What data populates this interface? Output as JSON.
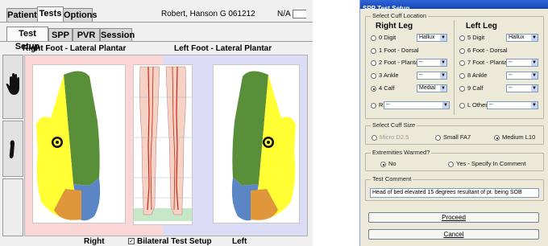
{
  "main_tabs": [
    {
      "label": "Patient"
    },
    {
      "label": "Tests"
    },
    {
      "label": "Options"
    }
  ],
  "patient_name": "Robert, Hanson G  061212",
  "status": "N/A",
  "sub_tabs": [
    {
      "label": "Test Setup"
    },
    {
      "label": "SPP"
    },
    {
      "label": "PVR"
    },
    {
      "label": "Session"
    }
  ],
  "right_foot_title": "Right Foot - Lateral Plantar",
  "left_foot_title": "Left Foot - Lateral Plantar",
  "bottom": {
    "right_label": "Right",
    "bilateral_label": "Bilateral Test Setup",
    "bilateral_checked": true,
    "left_label": "Left"
  },
  "dialog": {
    "title": "SPP Test Setup",
    "cuff_location_label": "Select Cuff Location",
    "right_leg_header": "Right Leg",
    "left_leg_header": "Left Leg",
    "right_options": [
      {
        "label": "0 Digit",
        "select": "Hallux",
        "selected": false
      },
      {
        "label": "1 Foot - Dorsal",
        "select": "",
        "selected": false
      },
      {
        "label": "2 Foot - Plantar",
        "select": "--",
        "selected": false
      },
      {
        "label": "3 Ankle",
        "select": "--",
        "selected": false
      },
      {
        "label": "4 Calf",
        "select": "Medial",
        "selected": true
      },
      {
        "label": "R Other",
        "select": "--",
        "selected": false
      }
    ],
    "left_options": [
      {
        "label": "5 Digit",
        "select": "Hallux",
        "selected": false
      },
      {
        "label": "6 Foot - Dorsal",
        "select": "",
        "selected": false
      },
      {
        "label": "7 Foot - Plantar",
        "select": "--",
        "selected": false
      },
      {
        "label": "8 Ankle",
        "select": "--",
        "selected": false
      },
      {
        "label": "9 Calf",
        "select": "--",
        "selected": false
      },
      {
        "label": "L Other",
        "select": "--",
        "selected": false
      }
    ],
    "cuff_size_label": "Select Cuff Size",
    "cuff_sizes": [
      {
        "label": "Micro D2.5",
        "enabled": false,
        "selected": false
      },
      {
        "label": "Small FA7",
        "enabled": true,
        "selected": false
      },
      {
        "label": "Medium L10",
        "enabled": true,
        "selected": true
      }
    ],
    "warmed_label": "Extremities Warmed?",
    "warmed_options": [
      {
        "label": "No",
        "selected": true
      },
      {
        "label": "Yes - Specify In Comment",
        "selected": false
      }
    ],
    "comment_label": "Test Comment",
    "comment_value": "Head of bed elevated 15 degrees resultant of pt. being SOB",
    "proceed_label": "Proceed",
    "cancel_label": "Cancel"
  },
  "colors": {
    "foot_yellow": "#ffff33",
    "foot_green": "#5a8f3a",
    "foot_blue": "#5b86c6",
    "foot_orange": "#e0963a",
    "right_bg": "#fbd6d6",
    "left_bg": "#dcdcf6",
    "dialog_title": "#1445b4"
  }
}
